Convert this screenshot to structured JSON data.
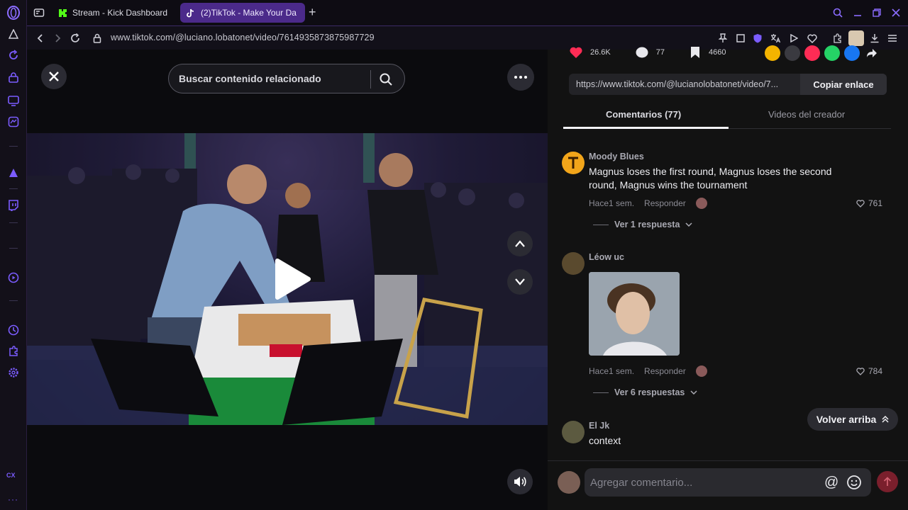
{
  "browser": {
    "tabs": [
      {
        "label": "Stream - Kick Dashboard",
        "active": false,
        "favicon": "kick-icon"
      },
      {
        "label": "(2)TikTok - Make Your Da",
        "active": true,
        "favicon": "tiktok-icon"
      }
    ],
    "url": "www.tiktok.com/@luciano.lobatonet/video/7614935873875987729",
    "sidebar_bottom_label": "CX"
  },
  "video": {
    "search_placeholder": "Buscar contenido relacionado"
  },
  "panel": {
    "stats": {
      "likes": "26.6K",
      "comments": "77",
      "saves": "4660"
    },
    "share_colors": [
      "#f4b400",
      "#3a3a40",
      "#fe2c55",
      "#25d366",
      "#1877f2"
    ],
    "copy_url": "https://www.tiktok.com/@lucianolobatonet/video/7...",
    "copy_button": "Copiar enlace",
    "tab_comments": "Comentarios (77)",
    "tab_creator": "Videos del creador",
    "comments": [
      {
        "user": "Moody Blues",
        "text": "Magnus loses the first round, Magnus loses the second round, Magnus wins the tournament",
        "time": "Hace1 sem.",
        "reply": "Responder",
        "likes": "761",
        "replies": "Ver 1 respuesta",
        "avatar_color": "#f2a51a"
      },
      {
        "user": "Léow uc",
        "text": "",
        "time": "Hace1 sem.",
        "reply": "Responder",
        "likes": "784",
        "replies": "Ver 6 respuestas",
        "avatar_color": "#5a4a2e"
      },
      {
        "user": "El Jk",
        "text": "context",
        "time": "",
        "reply": "",
        "likes": "",
        "replies": "",
        "avatar_color": "#5c5a40"
      }
    ],
    "back_top": "Volver arriba",
    "compose_placeholder": "Agregar comentario..."
  }
}
